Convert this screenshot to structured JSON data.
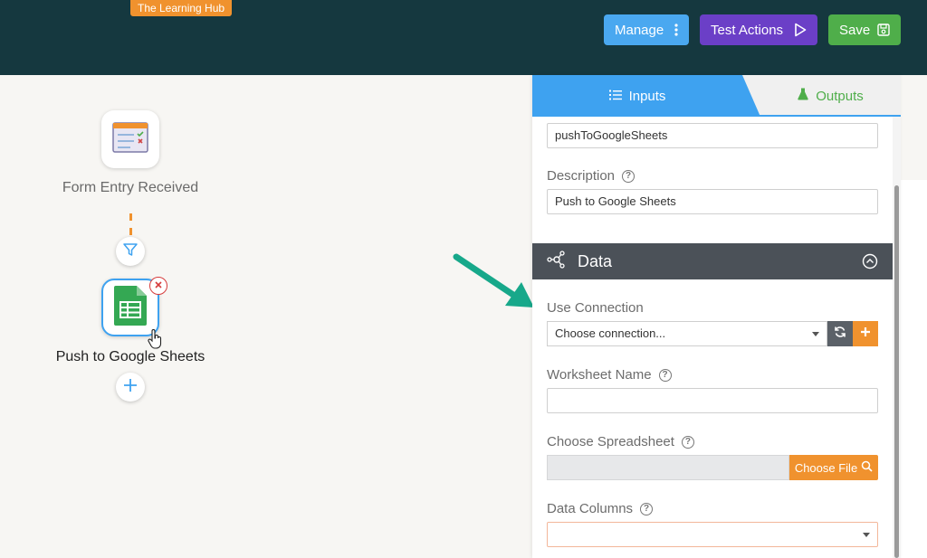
{
  "header": {
    "badge": "The Learning Hub",
    "manage_label": "Manage",
    "test_label": "Test Actions",
    "save_label": "Save"
  },
  "canvas": {
    "trigger_label": "Form Entry Received",
    "action_label": "Push to Google Sheets"
  },
  "panel": {
    "tabs": [
      {
        "label": "Inputs",
        "active": true
      },
      {
        "label": "Outputs",
        "active": false
      }
    ],
    "name_value": "pushToGoogleSheets",
    "description_label": "Description",
    "description_value": "Push to Google Sheets",
    "section_title": "Data",
    "use_connection_label": "Use Connection",
    "connection_placeholder": "Choose connection...",
    "worksheet_label": "Worksheet Name",
    "worksheet_value": "",
    "spreadsheet_label": "Choose Spreadsheet",
    "choose_file_label": "Choose File",
    "data_columns_label": "Data Columns"
  },
  "colors": {
    "topbar": "#15383f",
    "accent_blue": "#3ea2f0",
    "accent_orange": "#f0922e",
    "accent_green": "#4fae4a",
    "accent_purple": "#6b3fc7",
    "arrow_teal": "#17a88a"
  }
}
